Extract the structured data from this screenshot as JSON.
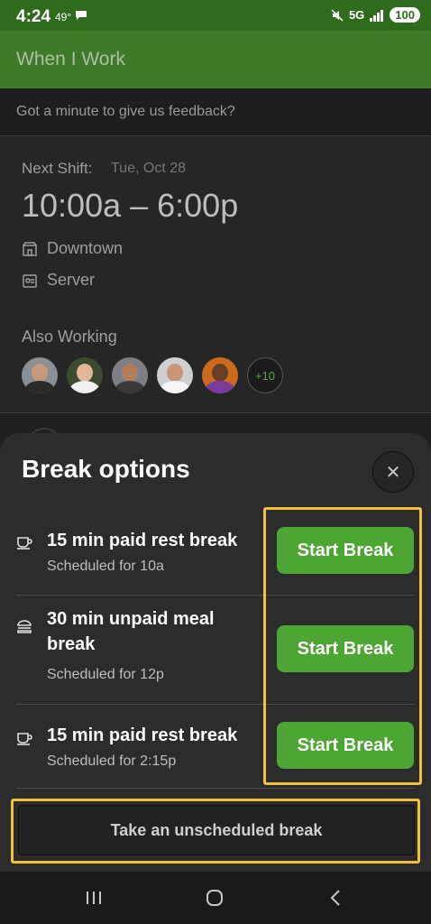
{
  "status": {
    "time": "4:24",
    "temp": "49°",
    "network": "5G",
    "battery": "100"
  },
  "app": {
    "title": "When I Work"
  },
  "feedback": {
    "text": "Got a minute to give us feedback?"
  },
  "shift": {
    "next_label": "Next Shift:",
    "date": "Tue, Oct 28",
    "time": "10:00a – 6:00p",
    "location": "Downtown",
    "position": "Server",
    "also_label": "Also Working",
    "more_count": "+10"
  },
  "sheet": {
    "title": "Break options",
    "breaks": [
      {
        "name": "15 min paid rest break",
        "scheduled": "Scheduled for 10a",
        "icon": "coffee-cup",
        "button": "Start Break"
      },
      {
        "name": "30 min unpaid meal break",
        "scheduled": "Scheduled for 12p",
        "icon": "burger",
        "button": "Start Break"
      },
      {
        "name": "15 min paid rest break",
        "scheduled": "Scheduled for 2:15p",
        "icon": "coffee-cup",
        "button": "Start Break"
      }
    ],
    "unscheduled_label": "Take an unscheduled break"
  },
  "colors": {
    "brand": "#3f7a2a",
    "button": "#4da533",
    "highlight": "#f2c23e"
  }
}
